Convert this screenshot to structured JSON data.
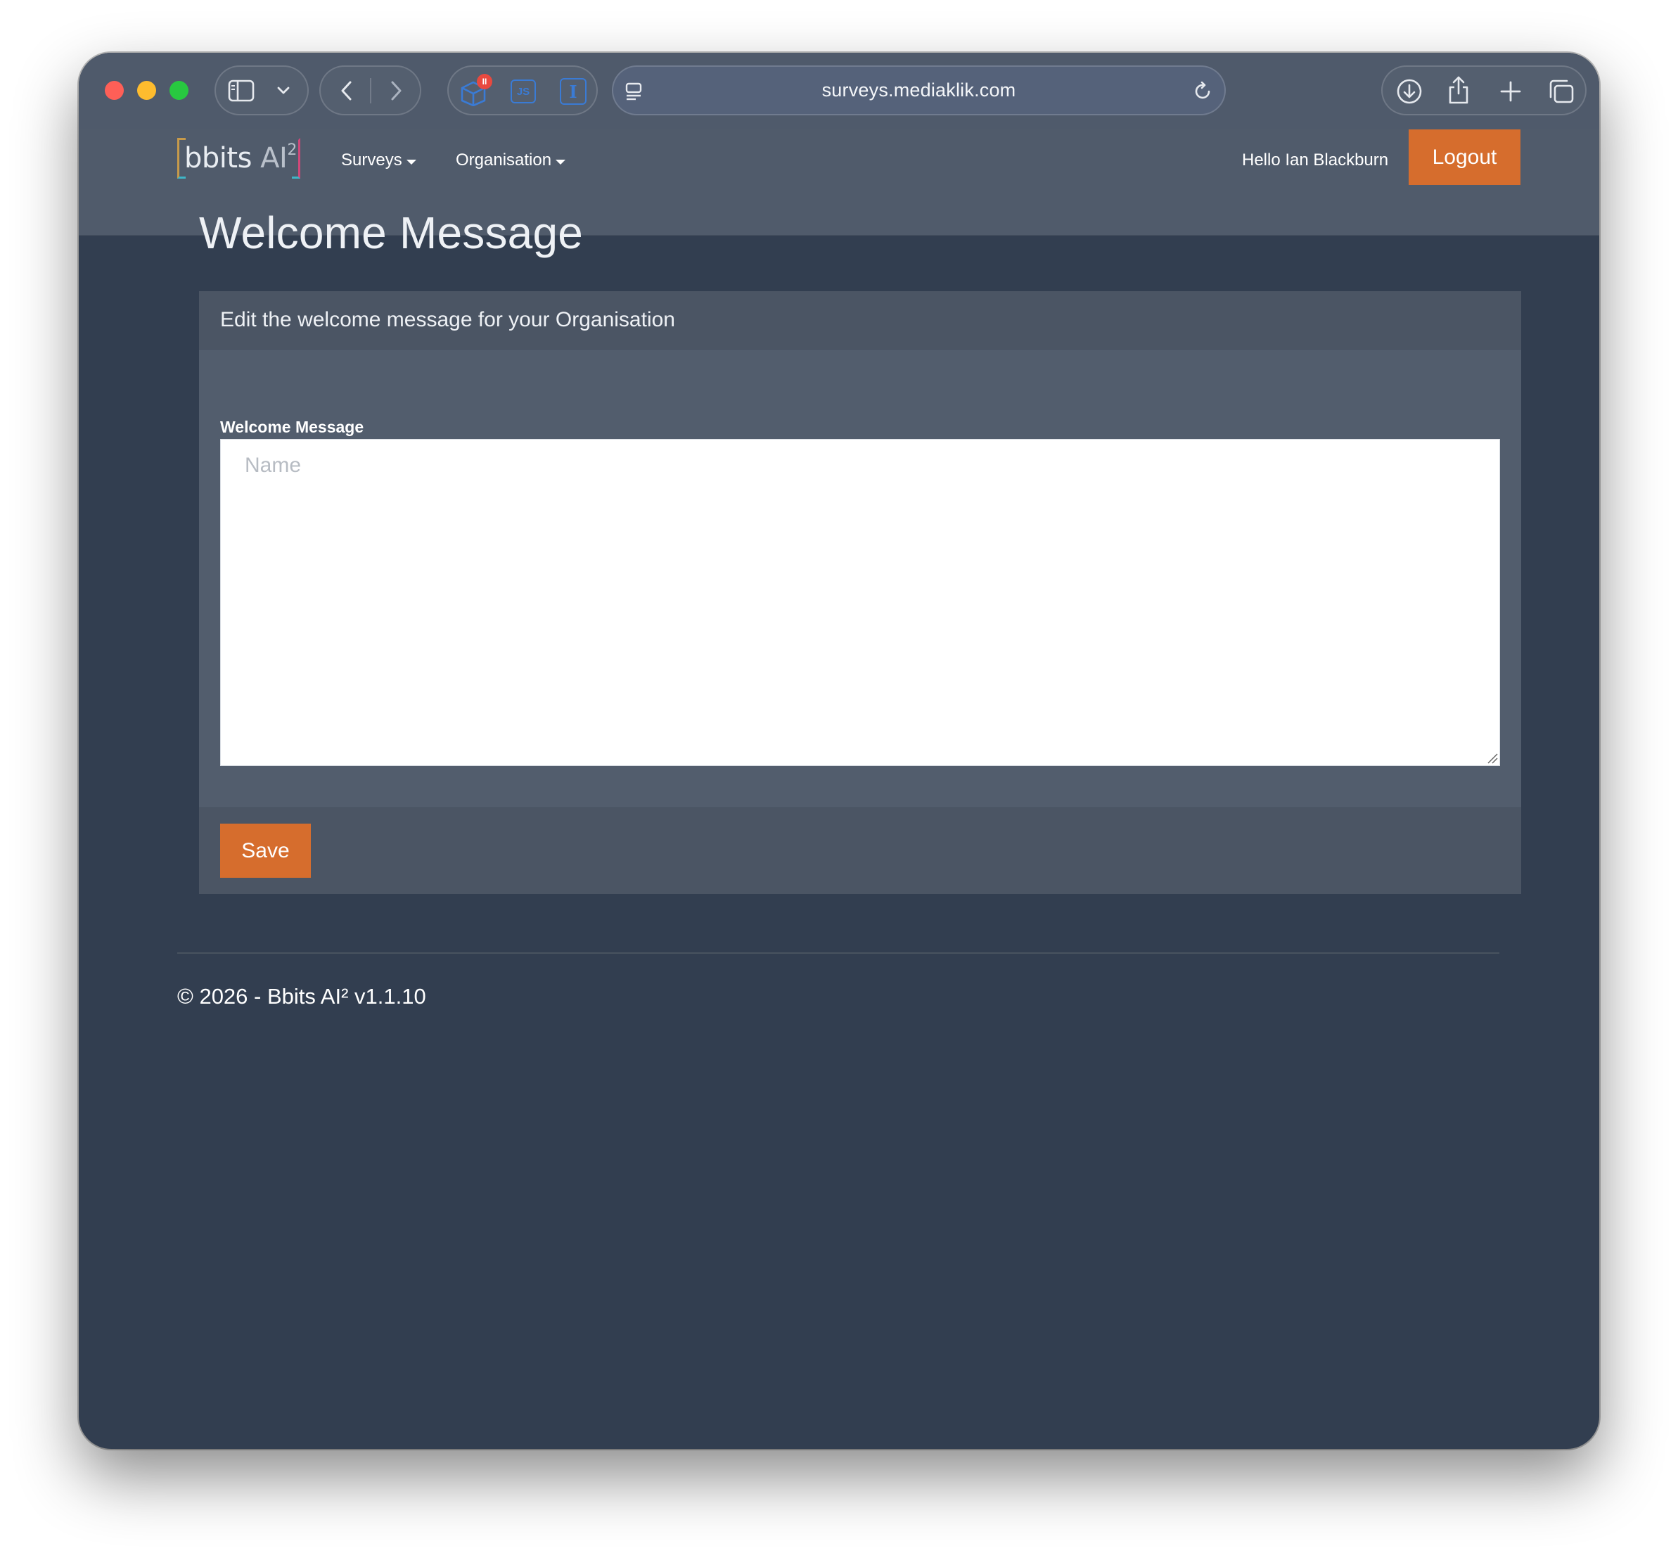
{
  "browser": {
    "url": "surveys.mediaklik.com",
    "extension_badge": "II",
    "extension_js_label": "JS",
    "extension_i_label": "I",
    "colors": {
      "close": "#fe5f57",
      "minimize": "#febc2e",
      "maximize": "#28c840"
    }
  },
  "navbar": {
    "logo_text": "bbits",
    "logo_ai": "AI",
    "logo_sup": "2",
    "menu": [
      {
        "label": "Surveys"
      },
      {
        "label": "Organisation"
      }
    ],
    "greeting": "Hello Ian Blackburn",
    "logout_label": "Logout"
  },
  "page": {
    "title": "Welcome Message",
    "card": {
      "header": "Edit the welcome message for your Organisation",
      "field_label": "Welcome Message",
      "field_placeholder": "Name",
      "field_value": ""
    },
    "save_label": "Save",
    "accent_color": "#d66d2d"
  },
  "footer": {
    "text": "© 2026 - Bbits AI² v1.1.10"
  }
}
